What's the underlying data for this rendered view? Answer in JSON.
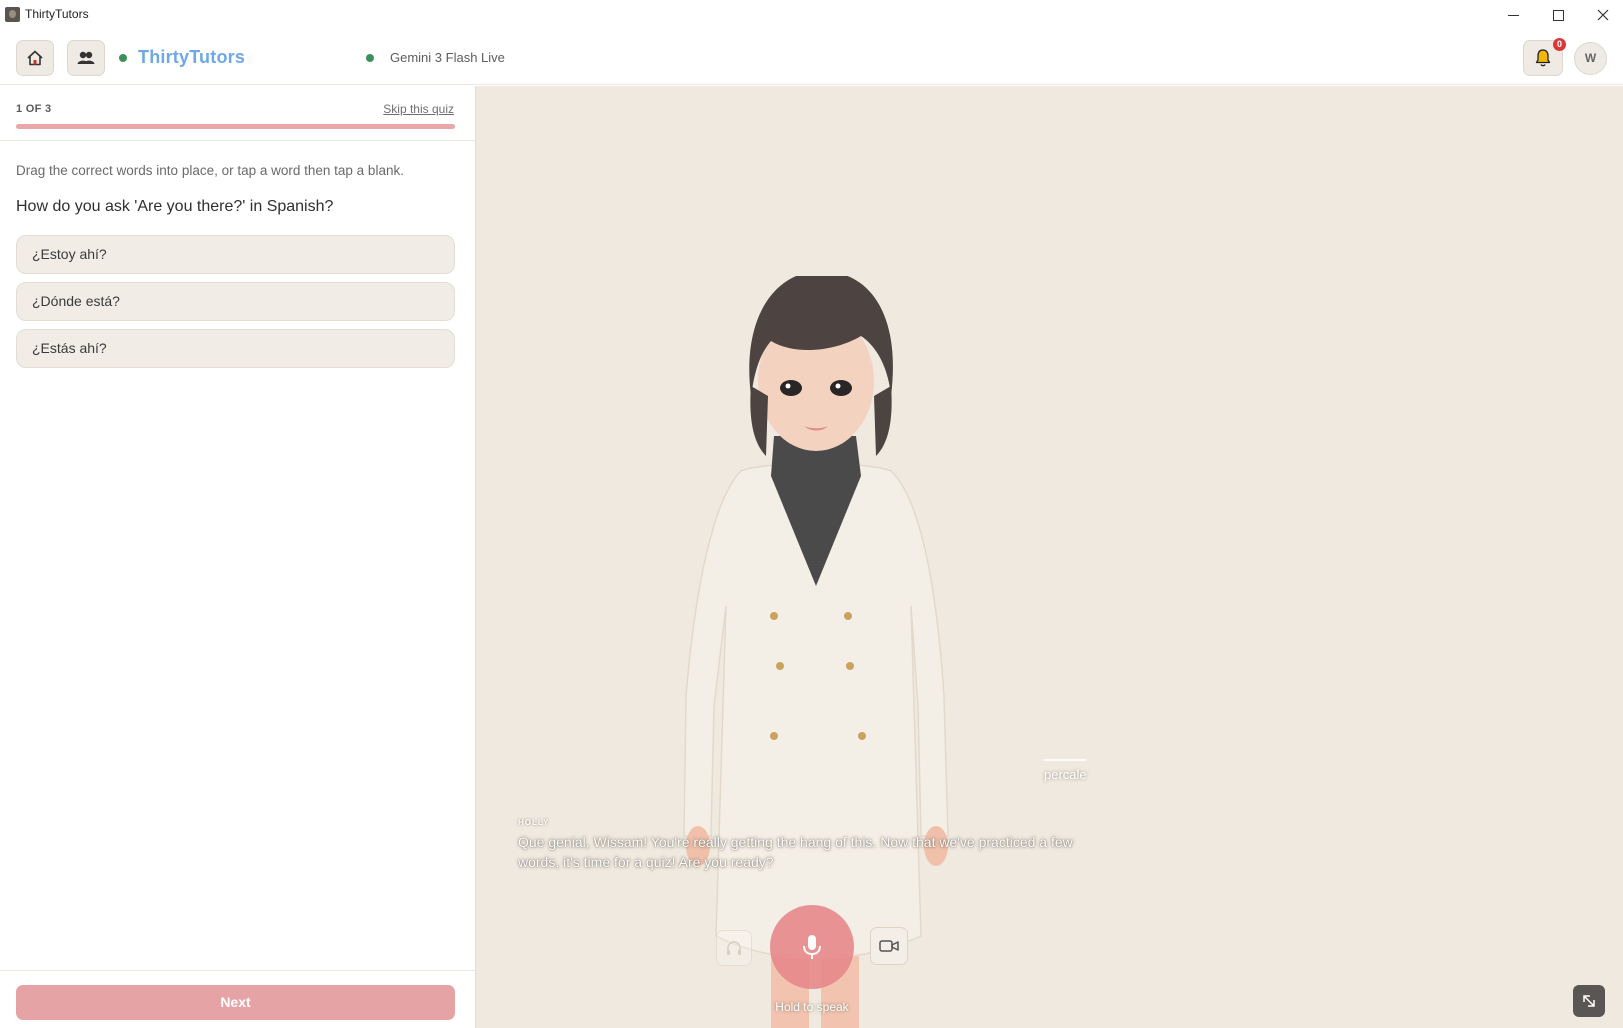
{
  "window": {
    "title": "ThirtyTutors"
  },
  "header": {
    "brand": "ThirtyTutors",
    "model": "Gemini 3 Flash Live",
    "notifications_count": "0",
    "avatar_initial": "W",
    "status_color": "#3f8f5b"
  },
  "quiz": {
    "counter": "1 OF 3",
    "skip_label": "Skip this quiz",
    "progress": 1,
    "instruction": "Drag the correct words into place, or tap a word then tap a blank.",
    "question": "How do you ask 'Are you there?' in Spanish?",
    "options": [
      "¿Estoy ahí?",
      "¿Dónde está?",
      "¿Estás ahí?"
    ],
    "next_label": "Next"
  },
  "stage": {
    "word_label": "percale",
    "speaker": "HOLLY",
    "subtitle": "Que genial, Wissam! You're really getting the hang of this. Now that we've practiced a few words, it's time for a quiz! Are you ready?",
    "hold_label": "Hold to speak"
  },
  "icons": {
    "home": "home-icon",
    "group": "group-icon",
    "bell": "bell-icon",
    "headphones": "headphones-icon",
    "mic": "mic-icon",
    "camera": "camera-icon",
    "collapse": "collapse-icon"
  },
  "colors": {
    "brand": "#6ea8e8",
    "accent": "#e6a3a6",
    "stage_bg": "#efe9df",
    "badge": "#d8383a"
  }
}
